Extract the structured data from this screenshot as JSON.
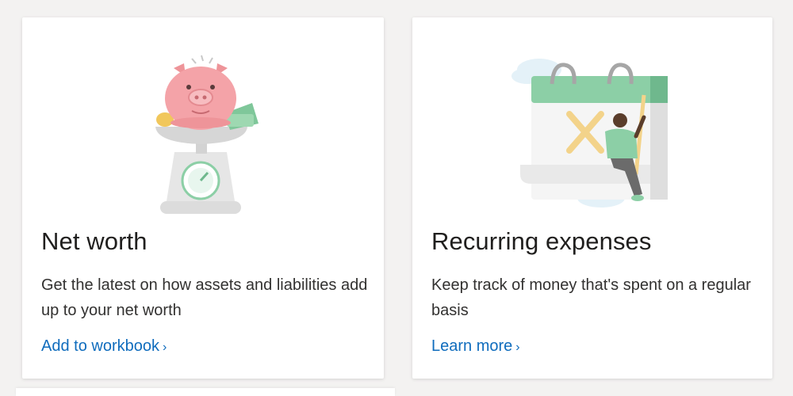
{
  "cards": [
    {
      "title": "Net worth",
      "description": "Get the latest on how assets and liabilities add up to your net worth",
      "link_label": "Add to workbook",
      "link_chevron": "›",
      "illustration": "piggy-bank-on-scale-icon"
    },
    {
      "title": "Recurring expenses",
      "description": "Keep track of money that's spent on a regular basis",
      "link_label": "Learn more",
      "link_chevron": "›",
      "illustration": "calendar-person-icon"
    }
  ],
  "colors": {
    "link": "#0f6cbd",
    "title": "#201f1e",
    "background": "#f3f2f1",
    "piggy_pink": "#f4a3a8",
    "calendar_green": "#8ccfa6"
  }
}
